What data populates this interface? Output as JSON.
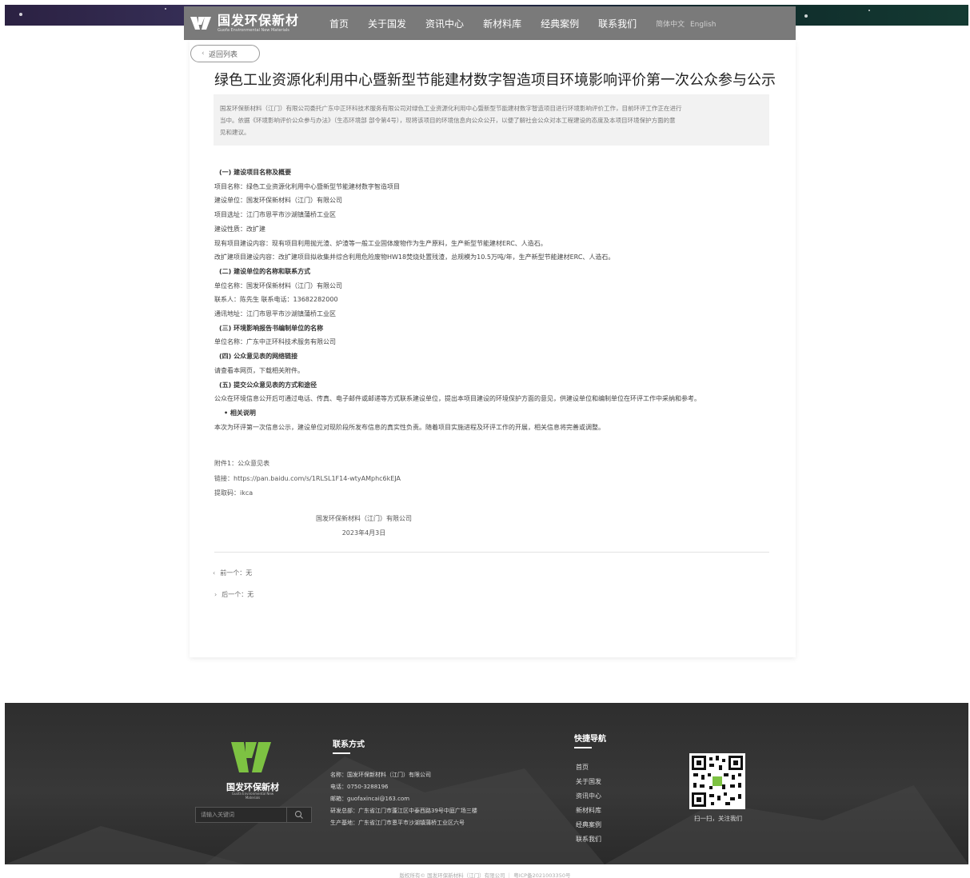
{
  "header": {
    "logo_text": "国发环保新材",
    "logo_sub": "Guofa Environmental New Materials",
    "nav": [
      "首页",
      "关于国发",
      "资讯中心",
      "新材料库",
      "经典案例",
      "联系我们"
    ],
    "lang": [
      "简体中文",
      "English"
    ]
  },
  "article": {
    "back_label": "返回列表",
    "title": "绿色工业资源化利用中心暨新型节能建材数字智造项目环境影响评价第一次公众参与公示",
    "summary": [
      "国发环保新材料（江门）有限公司委托广东中正环科技术服务有限公司对绿色工业资源化利用中心暨新型节能建材数字智造项目进行环境影响评价工作，目前环评工作正在进行",
      "当中。依据《环境影响评价公众参与办法》（生态环境部 部令第4号），现将该项目的环境信息向公众公开，以便了解社会公众对本工程建设的态度及本项目环境保护方面的意",
      "见和建议。"
    ],
    "body": [
      {
        "text": "(一) 建设项目名称及概要",
        "kind": "head"
      },
      {
        "text": "项目名称：绿色工业资源化利用中心暨新型节能建材数字智造项目",
        "kind": "text"
      },
      {
        "text": "建设单位：国发环保新材料（江门）有限公司",
        "kind": "text"
      },
      {
        "text": "项目选址：江门市恩平市沙湖镇蒲桥工业区",
        "kind": "text"
      },
      {
        "text": "建设性质：改扩建",
        "kind": "text"
      },
      {
        "text": "现有项目建设内容：现有项目利用抛光渣、炉渣等一般工业固体废物作为生产原料，生产新型节能建材ERC、人造石。",
        "kind": "text"
      },
      {
        "text": "改扩建项目建设内容：改扩建项目拟收集并综合利用危险废物HW18焚烧处置残渣，总规模为10.5万吨/年，生产新型节能建材ERC、人造石。",
        "kind": "text"
      },
      {
        "text": "(二) 建设单位的名称和联系方式",
        "kind": "head"
      },
      {
        "text": "单位名称：国发环保新材料（江门）有限公司",
        "kind": "text"
      },
      {
        "text": "联系人：陈先生   联系电话：13682282000",
        "kind": "text"
      },
      {
        "text": "通讯地址：江门市恩平市沙湖镇蒲桥工业区",
        "kind": "text"
      },
      {
        "text": "(三) 环境影响报告书编制单位的名称",
        "kind": "head"
      },
      {
        "text": "单位名称：广东中正环科技术服务有限公司",
        "kind": "text"
      },
      {
        "text": "(四) 公众意见表的网络链接",
        "kind": "head"
      },
      {
        "text": "请查看本网页，下载相关附件。",
        "kind": "text"
      },
      {
        "text": "(五) 提交公众意见表的方式和途径",
        "kind": "head"
      },
      {
        "text": "公众在环境信息公开后可通过电话、传真、电子邮件或邮递等方式联系建设单位，提出本项目建设的环境保护方面的意见，供建设单位和编制单位在环评工作中采纳和参考。",
        "kind": "text"
      },
      {
        "text": "•  相关说明",
        "kind": "bullet"
      },
      {
        "text": "本次为环评第一次信息公示，建设单位对现阶段所发布信息的真实性负责。随着项目实施进程及环评工作的开展，相关信息将完善或调整。",
        "kind": "text"
      }
    ],
    "attachment": {
      "file": "附件1：公众意见表",
      "link": "链接：https://pan.baidu.com/s/1RLSL1F14-wtyAMphc6kEJA",
      "code": "提取码：ikca"
    },
    "signature": {
      "company": "国发环保新材料（江门）有限公司",
      "date": "2023年4月3日"
    },
    "prev": "前一个：无",
    "next": "后一个：无"
  },
  "footer": {
    "logo_text": "国发环保新材",
    "logo_sub": "Guofa Environmental New Materials",
    "search_placeholder": "请输入关键词",
    "contact_title": "联系方式",
    "contact": [
      "名称：国发环保新材料（江门）有限公司",
      "电话：0750-3288196",
      "邮箱：guofaxincai@163.com",
      "研发总部：广东省江门市蓬江区中泰西路39号中庭广场三楼",
      "生产基地：广东省江门市恩平市沙湖镇蒲桥工业区六号"
    ],
    "nav_title": "快捷导航",
    "nav": [
      "首页",
      "关于国发",
      "资讯中心",
      "新材料库",
      "经典案例",
      "联系我们"
    ],
    "qr_caption": "扫一扫，关注我们",
    "copyright": "版权所有© 国发环保新材料（江门）有限公司 ｜ 粤ICP备2021003350号"
  },
  "colors": {
    "nav_bg": "#7a7a7a",
    "footer_bg": "#333333",
    "logo_green": "#7dc242"
  },
  "icons": [
    "logo-mark",
    "chevron-left-icon",
    "chevron-right-icon",
    "search-icon",
    "qr-code"
  ]
}
